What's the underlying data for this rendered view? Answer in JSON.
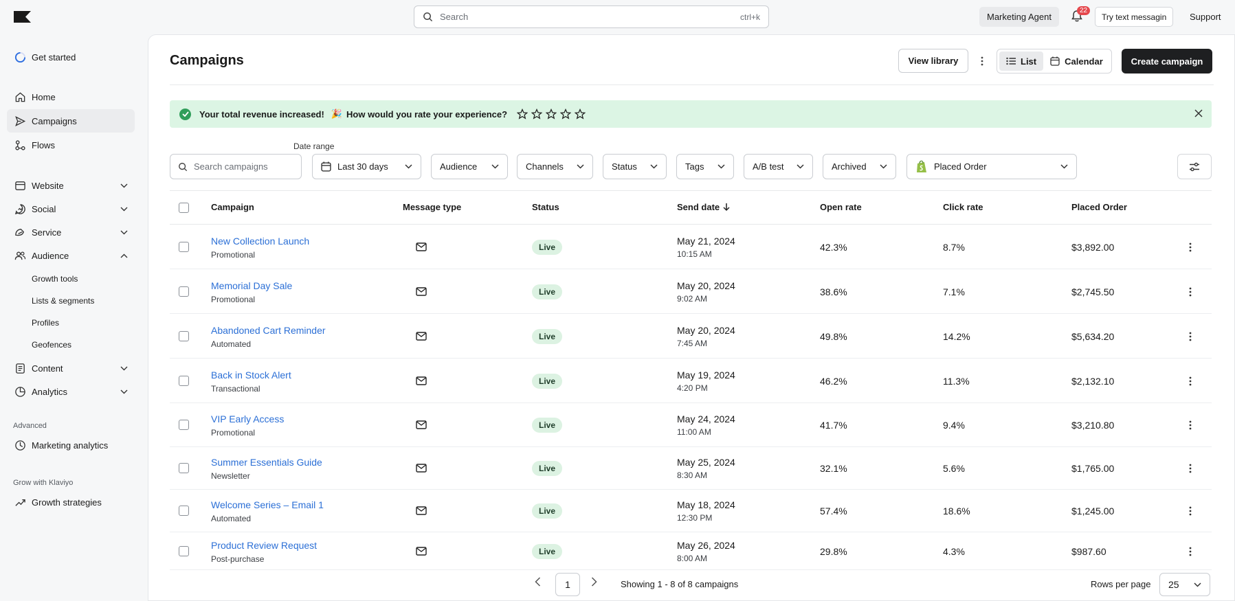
{
  "topbar": {
    "search_placeholder": "Search",
    "search_shortcut": "ctrl+k",
    "marketing_agent": "Marketing Agent",
    "notification_count": "22",
    "try_text": "Try text messagin",
    "support": "Support"
  },
  "sidebar": {
    "get_started": "Get started",
    "items": [
      {
        "label": "Home",
        "icon": "home-icon"
      },
      {
        "label": "Campaigns",
        "icon": "send-icon",
        "active": true
      },
      {
        "label": "Flows",
        "icon": "flows-icon"
      },
      {
        "label": "Website",
        "icon": "website-icon",
        "expandable": true
      },
      {
        "label": "Social",
        "icon": "social-icon",
        "expandable": true
      },
      {
        "label": "Service",
        "icon": "service-icon",
        "expandable": true
      },
      {
        "label": "Audience",
        "icon": "audience-icon",
        "expanded": true
      },
      {
        "label": "Content",
        "icon": "content-icon",
        "expandable": true
      },
      {
        "label": "Analytics",
        "icon": "analytics-icon",
        "expandable": true
      }
    ],
    "audience_sub": [
      "Growth tools",
      "Lists & segments",
      "Profiles",
      "Geofences"
    ],
    "advanced_heading": "Advanced",
    "marketing_analytics": "Marketing analytics",
    "grow_heading": "Grow with Klaviyo",
    "growth_strategies": "Growth strategies"
  },
  "header": {
    "title": "Campaigns",
    "view_library": "View library",
    "list": "List",
    "calendar": "Calendar",
    "create": "Create campaign"
  },
  "banner": {
    "text1": "Your total revenue increased!",
    "emoji": "🎉",
    "text2": "How would you rate your experience?",
    "stars": 5,
    "color": "#dcf5e4"
  },
  "filters": {
    "search_placeholder": "Search campaigns",
    "date_range_label": "Date range",
    "date_range": "Last 30 days",
    "audience": "Audience",
    "channels": "Channels",
    "status": "Status",
    "tags": "Tags",
    "ab_test": "A/B test",
    "archived": "Archived",
    "metric": "Placed Order"
  },
  "table": {
    "headers": {
      "campaign": "Campaign",
      "message_type": "Message type",
      "status": "Status",
      "send_date": "Send date",
      "open_rate": "Open rate",
      "click_rate": "Click rate",
      "placed_order": "Placed Order"
    },
    "rows": [
      {
        "name": "New Collection Launch",
        "type": "Promotional",
        "status": "Live",
        "date": "May 21, 2024",
        "time": "10:15 AM",
        "open": "42.3%",
        "click": "8.7%",
        "order": "$3,892.00"
      },
      {
        "name": "Memorial Day Sale",
        "type": "Promotional",
        "status": "Live",
        "date": "May 20, 2024",
        "time": "9:02 AM",
        "open": "38.6%",
        "click": "7.1%",
        "order": "$2,745.50"
      },
      {
        "name": "Abandoned Cart Reminder",
        "type": "Automated",
        "status": "Live",
        "date": "May 20, 2024",
        "time": "7:45 AM",
        "open": "49.8%",
        "click": "14.2%",
        "order": "$5,634.20"
      },
      {
        "name": "Back in Stock Alert",
        "type": "Transactional",
        "status": "Live",
        "date": "May 19, 2024",
        "time": "4:20 PM",
        "open": "46.2%",
        "click": "11.3%",
        "order": "$2,132.10"
      },
      {
        "name": "VIP Early Access",
        "type": "Promotional",
        "status": "Live",
        "date": "May 24, 2024",
        "time": "11:00 AM",
        "open": "41.7%",
        "click": "9.4%",
        "order": "$3,210.80"
      },
      {
        "name": "Summer Essentials Guide",
        "type": "Newsletter",
        "status": "Live",
        "date": "May 25, 2024",
        "time": "8:30 AM",
        "open": "32.1%",
        "click": "5.6%",
        "order": "$1,765.00"
      },
      {
        "name": "Welcome Series – Email 1",
        "type": "Automated",
        "status": "Live",
        "date": "May 18, 2024",
        "time": "12:30 PM",
        "open": "57.4%",
        "click": "18.6%",
        "order": "$1,245.00"
      },
      {
        "name": "Product Review Request",
        "type": "Post-purchase",
        "status": "Live",
        "date": "May 26, 2024",
        "time": "8:00 AM",
        "open": "29.8%",
        "click": "4.3%",
        "order": "$987.60"
      }
    ]
  },
  "pagination": {
    "page": "1",
    "info": "Showing 1 - 8 of 8 campaigns",
    "rows_per_page_label": "Rows per page",
    "rows_per_page": "25"
  }
}
